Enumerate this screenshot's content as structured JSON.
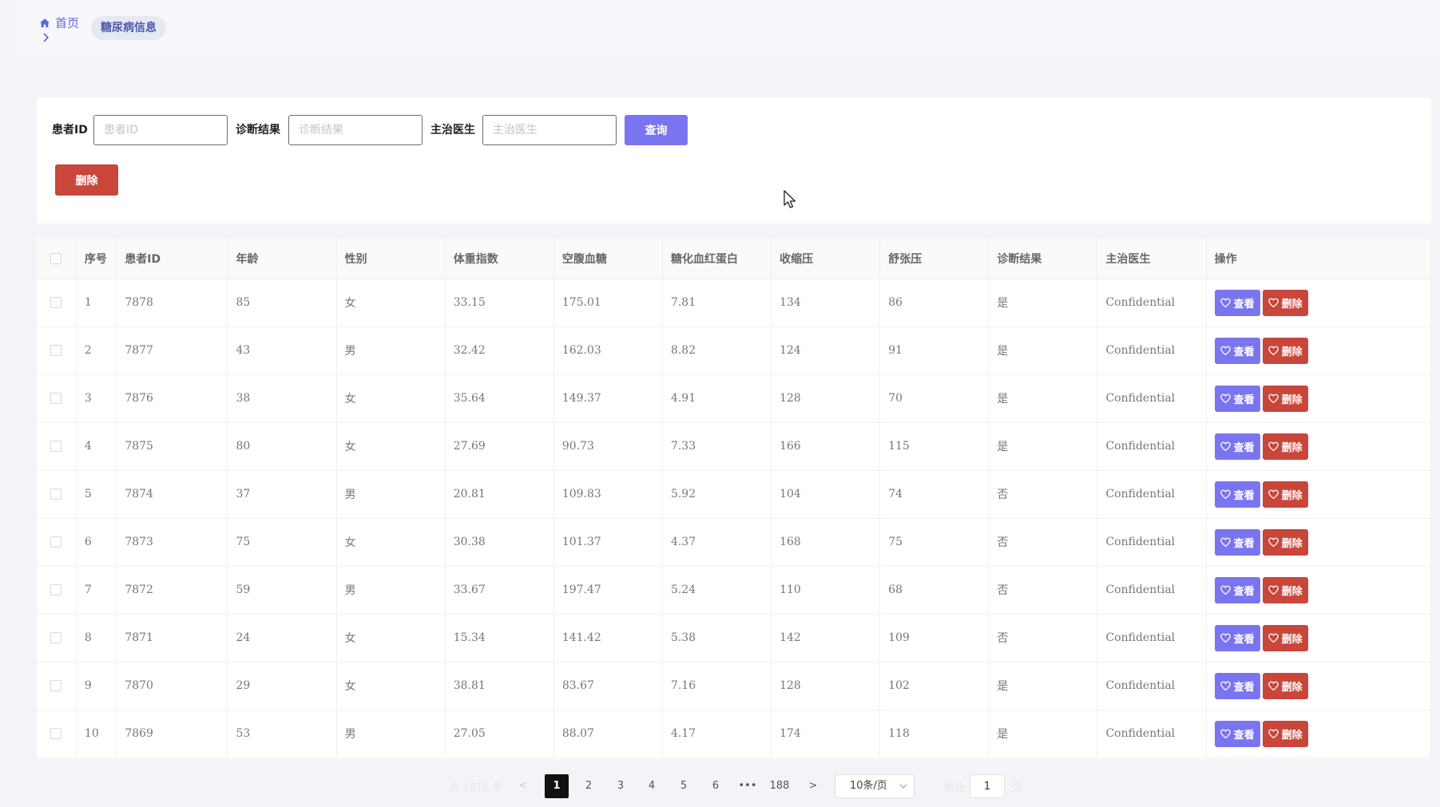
{
  "breadcrumb": {
    "home": "首页",
    "current": "糖尿病信息"
  },
  "search": {
    "patient_id_label": "患者ID",
    "patient_id_placeholder": "患者ID",
    "diagnosis_label": "诊断结果",
    "diagnosis_placeholder": "诊断结果",
    "doctor_label": "主治医生",
    "doctor_placeholder": "主治医生",
    "query_button": "查询",
    "delete_button": "删除"
  },
  "table": {
    "columns": [
      "序号",
      "患者ID",
      "年龄",
      "性别",
      "体重指数",
      "空腹血糖",
      "糖化血红蛋白",
      "收缩压",
      "舒张压",
      "诊断结果",
      "主治医生",
      "操作"
    ],
    "view_label": "查看",
    "delete_label": "删除",
    "rows": [
      {
        "index": "1",
        "patient_id": "7878",
        "age": "85",
        "sex": "女",
        "bmi": "33.15",
        "fasting_glucose": "175.01",
        "hba1c": "7.81",
        "systolic": "134",
        "diastolic": "86",
        "diagnosis": "是",
        "doctor": "Confidential"
      },
      {
        "index": "2",
        "patient_id": "7877",
        "age": "43",
        "sex": "男",
        "bmi": "32.42",
        "fasting_glucose": "162.03",
        "hba1c": "8.82",
        "systolic": "124",
        "diastolic": "91",
        "diagnosis": "是",
        "doctor": "Confidential"
      },
      {
        "index": "3",
        "patient_id": "7876",
        "age": "38",
        "sex": "女",
        "bmi": "35.64",
        "fasting_glucose": "149.37",
        "hba1c": "4.91",
        "systolic": "128",
        "diastolic": "70",
        "diagnosis": "是",
        "doctor": "Confidential"
      },
      {
        "index": "4",
        "patient_id": "7875",
        "age": "80",
        "sex": "女",
        "bmi": "27.69",
        "fasting_glucose": "90.73",
        "hba1c": "7.33",
        "systolic": "166",
        "diastolic": "115",
        "diagnosis": "是",
        "doctor": "Confidential"
      },
      {
        "index": "5",
        "patient_id": "7874",
        "age": "37",
        "sex": "男",
        "bmi": "20.81",
        "fasting_glucose": "109.83",
        "hba1c": "5.92",
        "systolic": "104",
        "diastolic": "74",
        "diagnosis": "否",
        "doctor": "Confidential"
      },
      {
        "index": "6",
        "patient_id": "7873",
        "age": "75",
        "sex": "女",
        "bmi": "30.38",
        "fasting_glucose": "101.37",
        "hba1c": "4.37",
        "systolic": "168",
        "diastolic": "75",
        "diagnosis": "否",
        "doctor": "Confidential"
      },
      {
        "index": "7",
        "patient_id": "7872",
        "age": "59",
        "sex": "男",
        "bmi": "33.67",
        "fasting_glucose": "197.47",
        "hba1c": "5.24",
        "systolic": "110",
        "diastolic": "68",
        "diagnosis": "否",
        "doctor": "Confidential"
      },
      {
        "index": "8",
        "patient_id": "7871",
        "age": "24",
        "sex": "女",
        "bmi": "15.34",
        "fasting_glucose": "141.42",
        "hba1c": "5.38",
        "systolic": "142",
        "diastolic": "109",
        "diagnosis": "否",
        "doctor": "Confidential"
      },
      {
        "index": "9",
        "patient_id": "7870",
        "age": "29",
        "sex": "女",
        "bmi": "38.81",
        "fasting_glucose": "83.67",
        "hba1c": "7.16",
        "systolic": "128",
        "diastolic": "102",
        "diagnosis": "是",
        "doctor": "Confidential"
      },
      {
        "index": "10",
        "patient_id": "7869",
        "age": "53",
        "sex": "男",
        "bmi": "27.05",
        "fasting_glucose": "88.07",
        "hba1c": "4.17",
        "systolic": "174",
        "diastolic": "118",
        "diagnosis": "是",
        "doctor": "Confidential"
      }
    ]
  },
  "pagination": {
    "total": "共 1876 条",
    "prev": "<",
    "next": ">",
    "pages": [
      "1",
      "2",
      "3",
      "4",
      "5",
      "6",
      "•••",
      "188"
    ],
    "active_page": "1",
    "page_size": "10条/页",
    "goto_label": "前往",
    "goto_value": "1",
    "goto_suffix": "页"
  },
  "colors": {
    "primary": "#7b74f0",
    "danger": "#c8463a",
    "breadcrumb_accent": "#5b6ad6"
  },
  "icons": {
    "home": "home-icon",
    "separator": "chevron-right-icon",
    "action": "heart-icon",
    "page_size_dropdown": "chevron-down-icon",
    "cursor": "mouse-cursor-icon"
  }
}
